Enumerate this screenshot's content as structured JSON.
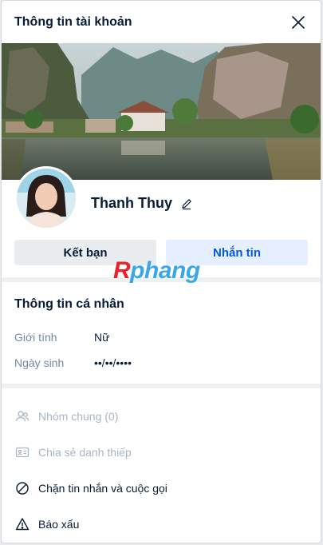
{
  "header": {
    "title": "Thông tin tài khoản"
  },
  "profile": {
    "name": "Thanh Thuy"
  },
  "actions": {
    "friend_label": "Kết bạn",
    "message_label": "Nhắn tin"
  },
  "watermark": {
    "part1": "R",
    "part2": "phang"
  },
  "personal_info": {
    "title": "Thông tin cá nhân",
    "rows": [
      {
        "label": "Giới tính",
        "value": "Nữ"
      },
      {
        "label": "Ngày sinh",
        "value": "••/••/••••"
      }
    ]
  },
  "menu": [
    {
      "label": "Nhóm chung (0)",
      "icon": "group-icon",
      "enabled": false
    },
    {
      "label": "Chia sẻ danh thiếp",
      "icon": "contact-card-icon",
      "enabled": false
    },
    {
      "label": "Chặn tin nhắn và cuộc gọi",
      "icon": "block-icon",
      "enabled": true
    },
    {
      "label": "Báo xấu",
      "icon": "warning-icon",
      "enabled": true
    }
  ],
  "colors": {
    "accent": "#005ae0",
    "accent_bg": "#e5efff",
    "text": "#081c36",
    "muted": "#7589a3",
    "disabled": "#a8b5c4"
  }
}
